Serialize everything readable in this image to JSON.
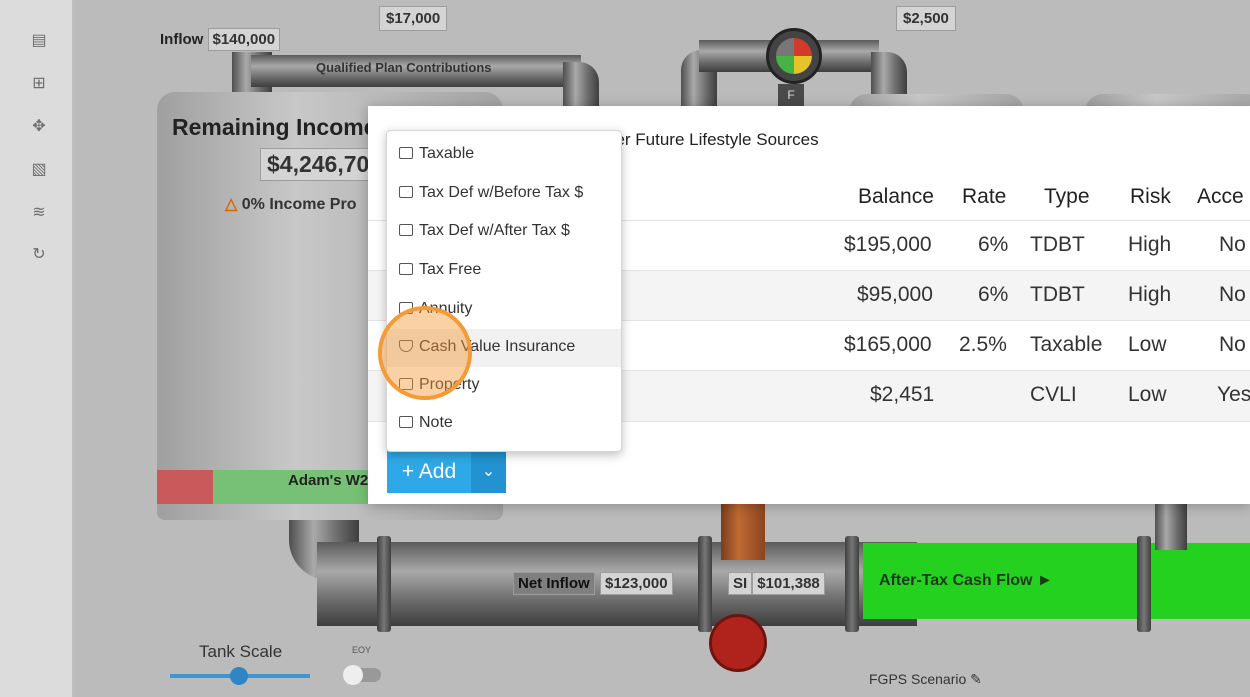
{
  "sidebar": {
    "icons": [
      "message-icon",
      "add-box-icon",
      "move-icon",
      "stack-icon",
      "rss-icon",
      "refresh-search-icon"
    ]
  },
  "canvas": {
    "top_amount_1": "$17,000",
    "top_amount_2": "$2,500",
    "inflow_label": "Inflow",
    "inflow_value": "$140,000",
    "qualified_plan": "Qualified Plan Contributions",
    "tank_title": "Remaining Income",
    "tank_amount": "$4,246,70",
    "tank_warning": "0% Income Pro",
    "tank_footer": "Adam's W2",
    "gauge_letter": "F",
    "net_inflow_label": "Net Inflow",
    "net_inflow_value": "$123,000",
    "si_label": "SI",
    "si_value": "$101,388",
    "after_tax": "After-Tax Cash Flow ►",
    "tank_scale": "Tank Scale",
    "toggle_label": "EOY",
    "fgps_label": "FGPS Scenario"
  },
  "modal": {
    "title": "her Future Lifestyle Sources",
    "columns": [
      "Balance",
      "Rate",
      "Type",
      "Risk",
      "Acce"
    ],
    "rows": [
      {
        "balance": "$195,000",
        "rate": "6%",
        "type": "TDBT",
        "risk": "High",
        "access": "No"
      },
      {
        "balance": "$95,000",
        "rate": "6%",
        "type": "TDBT",
        "risk": "High",
        "access": "No"
      },
      {
        "balance": "$165,000",
        "rate": "2.5%",
        "type": "Taxable",
        "risk": "Low",
        "access": "No"
      },
      {
        "balance": "$2,451",
        "rate": "",
        "type": "CVLI",
        "risk": "Low",
        "access": "Yes"
      }
    ],
    "add_button": "+ Add",
    "add_caret": "⌄"
  },
  "dropdown": {
    "items": [
      "Taxable",
      "Tax Def w/Before Tax $",
      "Tax Def w/After Tax $",
      "Tax Free",
      "Annuity",
      "Cash Value Insurance",
      "Property",
      "Note"
    ],
    "highlighted": "Cash Value Insurance"
  },
  "colors": {
    "accent": "#2ea8e6",
    "green_flow": "#24d11f",
    "click_marker": "#f49a37"
  }
}
